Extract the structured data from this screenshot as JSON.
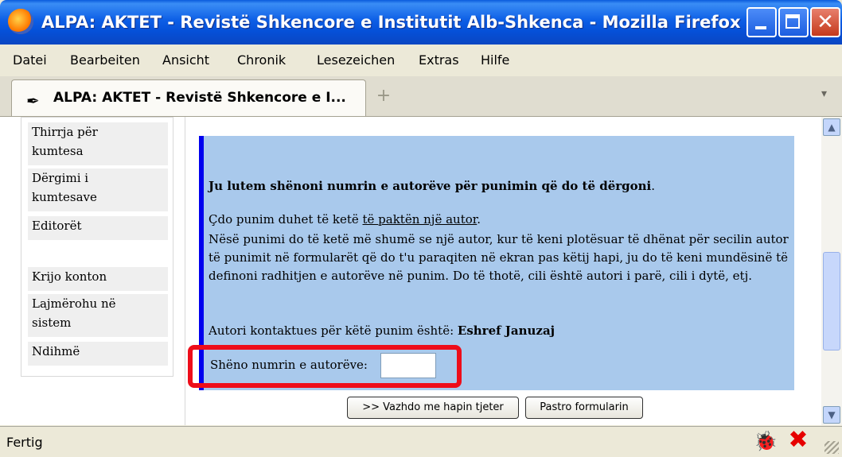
{
  "window": {
    "title": "ALPA: AKTET - Revistë Shkencore e Institutit Alb-Shkenca - Mozilla Firefox"
  },
  "menu": [
    "Datei",
    "Bearbeiten",
    "Ansicht",
    "Chronik",
    "Lesezeichen",
    "Extras",
    "Hilfe"
  ],
  "tab": {
    "label": "ALPA: AKTET - Revistë Shkencore e I...",
    "new_tab_symbol": "+"
  },
  "sidebar": {
    "items": [
      {
        "label": "Thirrja për\nkumtesa"
      },
      {
        "label": "Dërgimi i\nkumtesave"
      },
      {
        "label": "Editorët"
      },
      {
        "label": "Krijo konton"
      },
      {
        "label": "Lajmërohu në\nsistem"
      },
      {
        "label": "Ndihmë"
      }
    ]
  },
  "form": {
    "heading": "Ju lutem shënoni numrin e autorëve për punimin që do të dërgoni",
    "heading_end": ".",
    "line1_prefix": "Çdo punim duhet të ketë ",
    "line1_link": "të paktën një autor",
    "line1_suffix": ".",
    "paragraph": "Nësë punimi do të ketë më shumë se një autor, kur të keni plotësuar të dhënat për secilin autor të punimit në formularët që do t'u paraqiten në ekran pas këtij hapi, ju do të keni mundësinë të definoni radhitjen e autorëve në punim. Do të thotë, cili është autori i parë, cili i dytë, etj.",
    "contact_prefix": "Autori kontaktues për këtë punim është: ",
    "contact_name": "Eshref Januzaj",
    "author_count_label": "Shëno numrin e autorëve:",
    "author_count_value": "",
    "next_button": ">> Vazhdo me hapin tjeter",
    "clear_button": "Pastro formularin"
  },
  "status": {
    "text": "Fertig"
  },
  "colors": {
    "panel": "#a9c9ec",
    "highlight": "#ee0d1a",
    "accent_bar": "#0000ee"
  }
}
